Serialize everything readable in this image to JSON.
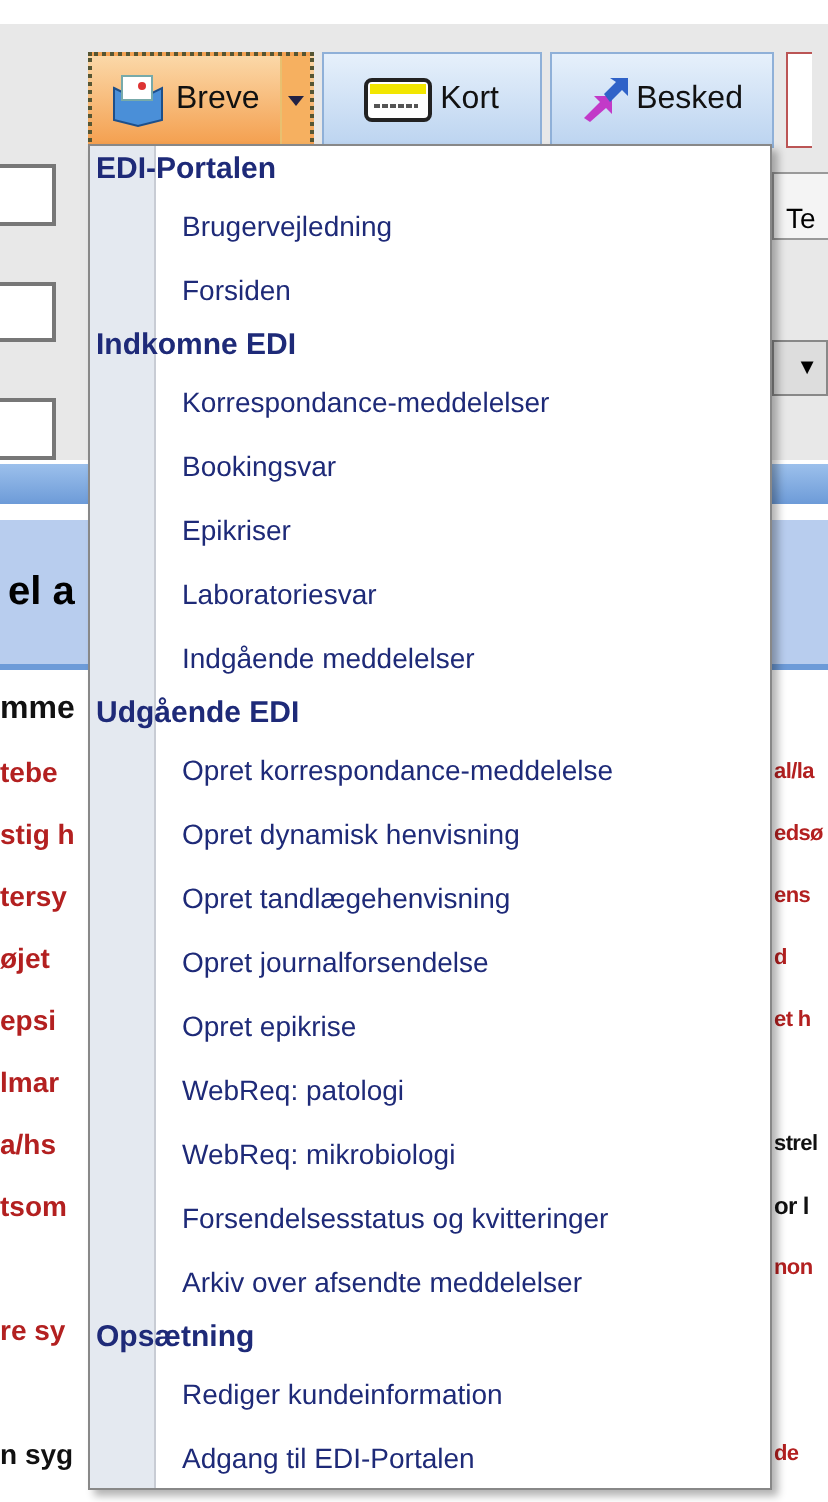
{
  "toolbar": [
    {
      "label": "Breve",
      "kind": "letter",
      "selected": true,
      "has_dropdown": true
    },
    {
      "label": "Kort",
      "kind": "card",
      "selected": false,
      "has_dropdown": false
    },
    {
      "label": "Besked",
      "kind": "message",
      "selected": false,
      "has_dropdown": false
    }
  ],
  "side_button": {
    "label": "Te"
  },
  "dropdown_arrow": "▼",
  "panel_fragment": "el a",
  "menu": [
    {
      "heading": "EDI-Portalen",
      "items": [
        "Brugervejledning",
        "Forsiden"
      ]
    },
    {
      "heading": "Indkomne EDI",
      "items": [
        "Korrespondance-meddelelser",
        "Bookingsvar",
        "Epikriser",
        "Laboratoriesvar",
        "Indgående meddelelser"
      ]
    },
    {
      "heading": "Udgående EDI",
      "items": [
        "Opret korrespondance-meddelelse",
        "Opret dynamisk henvisning",
        "Opret tandlægehenvisning",
        "Opret journalforsendelse",
        "Opret epikrise",
        "WebReq: patologi",
        "WebReq: mikrobiologi",
        "Forsendelsesstatus og kvitteringer",
        "Arkiv over afsendte meddelelser"
      ]
    },
    {
      "heading": "Opsætning",
      "items": [
        "Rediger kundeinformation",
        "Adgang til EDI-Portalen"
      ]
    }
  ],
  "background_rows": [
    {
      "left": {
        "text": "mme",
        "kind": "heading"
      }
    },
    {
      "left": {
        "text": "tebe",
        "kind": "link"
      },
      "right": {
        "text": "al/la",
        "kind": "link"
      }
    },
    {
      "left": {
        "text": "stig h",
        "kind": "link"
      },
      "right": {
        "text": "edsø",
        "kind": "link"
      }
    },
    {
      "left": {
        "text": "tersy",
        "kind": "link"
      },
      "right": {
        "text": "ens",
        "kind": "link"
      }
    },
    {
      "left": {
        "text": "øjet",
        "kind": "link"
      },
      "right": {
        "text": "d",
        "kind": "link"
      }
    },
    {
      "left": {
        "text": "epsi",
        "kind": "link"
      },
      "right": {
        "text": "et h",
        "kind": "link"
      }
    },
    {
      "left": {
        "text": "lmar",
        "kind": "link"
      }
    },
    {
      "left": {
        "text": "a/hs",
        "kind": "link"
      },
      "right": {
        "text": "strel",
        "kind": "text"
      }
    },
    {
      "left": {
        "text": "tsom",
        "kind": "link"
      },
      "right": {
        "text": "or l",
        "kind": "heading"
      }
    },
    {
      "right": {
        "text": "non",
        "kind": "link"
      }
    },
    {
      "left": {
        "text": "re sy",
        "kind": "link"
      }
    },
    {},
    {
      "left": {
        "text": "n syg",
        "kind": "text"
      },
      "right": {
        "text": "de",
        "kind": "link"
      }
    }
  ]
}
